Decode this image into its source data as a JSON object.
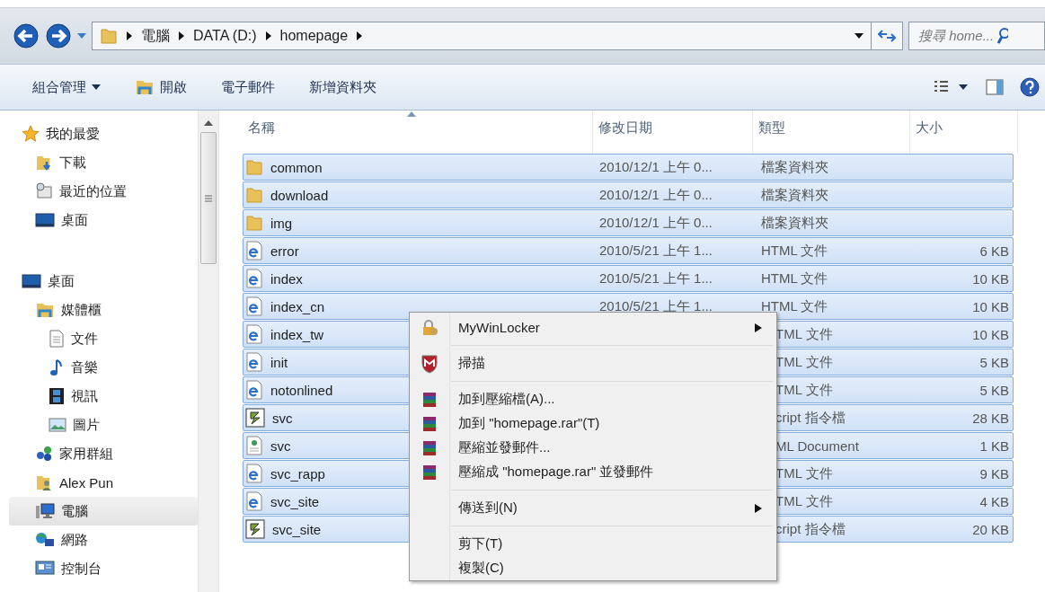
{
  "address": {
    "crumbs": [
      "電腦",
      "DATA (D:)",
      "homepage"
    ]
  },
  "search": {
    "placeholder": "搜尋 home..."
  },
  "toolbar": [
    {
      "label": "組合管理",
      "kind": "dropdown"
    },
    {
      "label": "開啟",
      "kind": "open"
    },
    {
      "label": "電子郵件",
      "kind": "plain"
    },
    {
      "label": "新增資料夾",
      "kind": "plain"
    }
  ],
  "sidebar": {
    "groups": [
      {
        "label": "我的最愛",
        "kind": "star",
        "selected": false,
        "children": [
          {
            "label": "下載",
            "kind": "download",
            "selected": false
          },
          {
            "label": "最近的位置",
            "kind": "recent",
            "selected": false
          },
          {
            "label": "桌面",
            "kind": "desktop",
            "selected": false
          }
        ]
      },
      {
        "label": "桌面",
        "kind": "desktop",
        "selected": false,
        "children": [
          {
            "label": "媒體櫃",
            "kind": "library",
            "selected": false,
            "children": [
              {
                "label": "文件",
                "kind": "document",
                "selected": false
              },
              {
                "label": "音樂",
                "kind": "music",
                "selected": false
              },
              {
                "label": "視訊",
                "kind": "video",
                "selected": false
              },
              {
                "label": "圖片",
                "kind": "picture",
                "selected": false
              }
            ]
          },
          {
            "label": "家用群組",
            "kind": "homegroup",
            "selected": false
          },
          {
            "label": "Alex Pun",
            "kind": "user",
            "selected": false
          },
          {
            "label": "電腦",
            "kind": "computer",
            "selected": true
          },
          {
            "label": "網路",
            "kind": "network",
            "selected": false
          },
          {
            "label": "控制台",
            "kind": "control",
            "selected": false
          }
        ]
      }
    ]
  },
  "table": {
    "columns": [
      {
        "label": "名稱",
        "sorted": true
      },
      {
        "label": "修改日期",
        "sorted": false
      },
      {
        "label": "類型",
        "sorted": false
      },
      {
        "label": "大小",
        "sorted": false
      }
    ],
    "rows": [
      {
        "name": "common",
        "kind": "folder",
        "date": "2010/12/1 上午 0...",
        "type": "檔案資料夾",
        "selected": true,
        "covered": false
      },
      {
        "name": "download",
        "kind": "folder",
        "date": "2010/12/1 上午 0...",
        "type": "檔案資料夾",
        "selected": true,
        "covered": false
      },
      {
        "name": "img",
        "kind": "folder",
        "date": "2010/12/1 上午 0...",
        "type": "檔案資料夾",
        "selected": true,
        "covered": false
      },
      {
        "name": "error",
        "kind": "html",
        "date": "2010/5/21 上午 1...",
        "type": "HTML 文件",
        "size": "6 KB",
        "selected": true,
        "covered": false
      },
      {
        "name": "index",
        "kind": "html",
        "date": "2010/5/21 上午 1...",
        "type": "HTML 文件",
        "size": "10 KB",
        "selected": true,
        "covered": false
      },
      {
        "name": "index_cn",
        "kind": "html",
        "date": "2010/5/21 上午 1...",
        "type": "HTML 文件",
        "size": "10 KB",
        "selected": true,
        "covered": false
      },
      {
        "name": "index_tw",
        "kind": "html",
        "type": "TML 文件",
        "size": "10 KB",
        "selected": true,
        "covered": true
      },
      {
        "name": "init",
        "kind": "html",
        "type": "TML 文件",
        "size": "5 KB",
        "selected": true,
        "covered": true
      },
      {
        "name": "notonlined",
        "kind": "html",
        "type": "TML 文件",
        "size": "5 KB",
        "selected": true,
        "covered": true
      },
      {
        "name": "svc",
        "kind": "script",
        "type": "cript 指令檔",
        "size": "28 KB",
        "selected": true,
        "covered": true
      },
      {
        "name": "svc",
        "kind": "xml",
        "type": "ML Document",
        "size": "1 KB",
        "selected": true,
        "covered": true
      },
      {
        "name": "svc_rapp",
        "kind": "html",
        "type": "TML 文件",
        "size": "9 KB",
        "selected": true,
        "covered": true
      },
      {
        "name": "svc_site",
        "kind": "html",
        "type": "TML 文件",
        "size": "4 KB",
        "selected": true,
        "covered": true
      },
      {
        "name": "svc_site",
        "kind": "script",
        "type": "cript 指令檔",
        "size": "20 KB",
        "selected": true,
        "covered": true
      }
    ]
  },
  "context_menu": [
    {
      "kind": "lock",
      "label": "MyWinLocker",
      "submenu": true
    },
    {
      "kind": "separator"
    },
    {
      "kind": "shield",
      "label": "掃描",
      "submenu": false
    },
    {
      "kind": "separator"
    },
    {
      "kind": "archive",
      "label": "加到壓縮檔(A)...",
      "submenu": false
    },
    {
      "kind": "archive",
      "label": "加到 \"homepage.rar\"(T)",
      "submenu": false
    },
    {
      "kind": "archive",
      "label": "壓縮並發郵件...",
      "submenu": false
    },
    {
      "kind": "archive",
      "label": "壓縮成 \"homepage.rar\" 並發郵件",
      "submenu": false
    },
    {
      "kind": "separator"
    },
    {
      "kind": "plain",
      "label": "傳送到(N)",
      "submenu": true
    },
    {
      "kind": "separator"
    },
    {
      "kind": "plain",
      "label": "剪下(T)",
      "submenu": false
    },
    {
      "kind": "plain",
      "label": "複製(C)",
      "submenu": false
    }
  ]
}
